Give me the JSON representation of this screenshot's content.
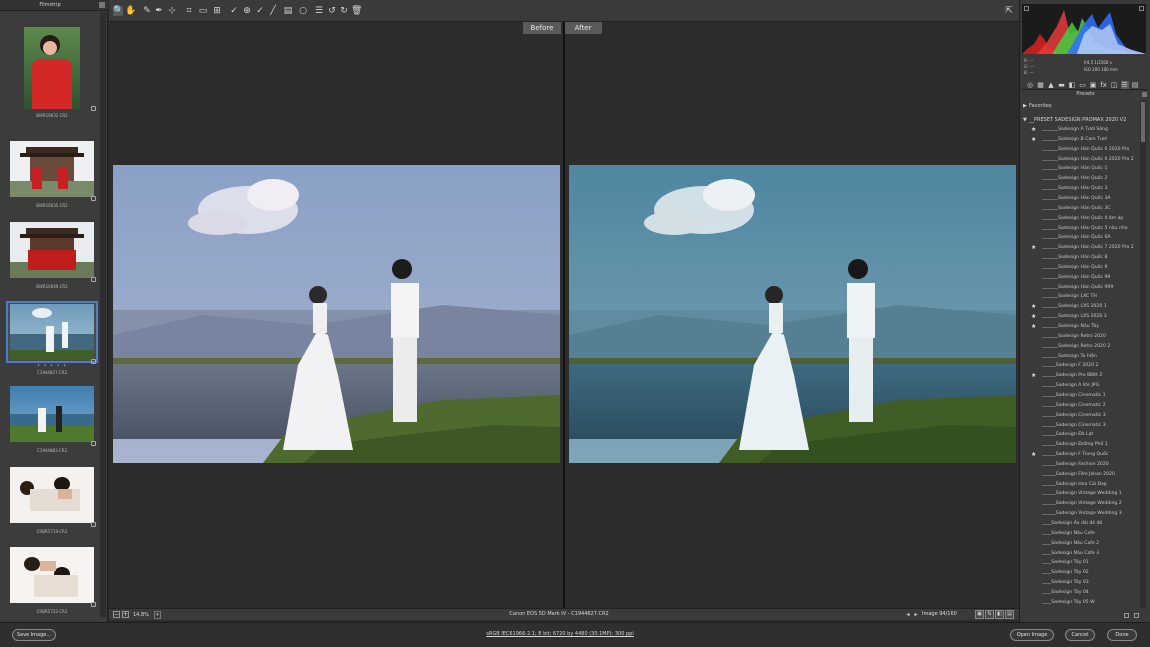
{
  "filmstrip": {
    "title": "Filmstrip",
    "items": [
      {
        "caption": "BWR10632.CR2",
        "thumb": "portrait-red-dress",
        "stars": ""
      },
      {
        "caption": "BWR10635.CR2",
        "thumb": "temple-couple",
        "stars": ""
      },
      {
        "caption": "BWR10649.CR2",
        "thumb": "temple-group",
        "stars": ""
      },
      {
        "caption": "C1944827.CR2",
        "thumb": "lake-couple",
        "stars": "• • • • •",
        "selected": true
      },
      {
        "caption": "C1944883.CR2",
        "thumb": "lake-couple-2",
        "stars": ""
      },
      {
        "caption": "C9DR5719.CR2",
        "thumb": "bed-couple",
        "stars": ""
      },
      {
        "caption": "C9DR5722.CR2",
        "thumb": "bed-couple-2",
        "stars": ""
      }
    ]
  },
  "toolbar": {
    "tools": [
      {
        "name": "zoom-tool",
        "glyph": "🔍"
      },
      {
        "name": "hand-tool",
        "glyph": "✋"
      },
      {
        "name": "white-balance-tool",
        "glyph": "✎"
      },
      {
        "name": "color-sampler-tool",
        "glyph": "✒"
      },
      {
        "name": "targeted-adjustment-tool",
        "glyph": "⊹"
      },
      {
        "name": "crop-tool",
        "glyph": "⌗"
      },
      {
        "name": "straighten-tool",
        "glyph": "▭"
      },
      {
        "name": "transform-tool",
        "glyph": "⊞"
      },
      {
        "name": "spot-removal-tool",
        "glyph": "✓"
      },
      {
        "name": "red-eye-tool",
        "glyph": "⊕"
      },
      {
        "name": "adjustment-brush-tool",
        "glyph": "✓"
      },
      {
        "name": "graduated-filter-tool",
        "glyph": "╱"
      },
      {
        "name": "radial-filter-tool",
        "glyph": "▤"
      },
      {
        "name": "preferences-tool",
        "glyph": "○"
      },
      {
        "name": "list-tool",
        "glyph": "☰"
      },
      {
        "name": "rotate-left-tool",
        "glyph": "↺"
      },
      {
        "name": "rotate-right-tool",
        "glyph": "↻"
      },
      {
        "name": "trash-tool",
        "glyph": "🗑"
      }
    ],
    "fullscreen_glyph": "⇱"
  },
  "preview": {
    "before_label": "Before",
    "after_label": "After"
  },
  "status": {
    "zoom": "14.8%",
    "camera": "Canon EOS 5D Mark IV  -  C1944827.CR2",
    "image_count": "Image 94/160"
  },
  "histogram": {
    "r_label": "R:",
    "g_label": "G:",
    "b_label": "B:",
    "r_value": "---",
    "g_value": "---",
    "b_value": "---",
    "exposure_line1": "f/4.5     1/2500 s",
    "exposure_line2": "ISO 200    100 mm"
  },
  "panel_tabs": [
    "◎",
    "▦",
    "▲",
    "▬",
    "◧",
    "▭",
    "▣",
    "fx",
    "◫",
    "☰",
    "▤"
  ],
  "presets": {
    "title": "Presets",
    "favorites_label": "Favorites",
    "group_label": "__PRESET SADESIGN PROMAX 2020 V2",
    "items": [
      {
        "name": "_______Sadesign A Tươi Sáng",
        "star": true
      },
      {
        "name": "_______Sadesign B  Cam Tươi",
        "star": true
      },
      {
        "name": "_______Sadesign Hàn Quốc 0 2020 Pro",
        "star": false
      },
      {
        "name": "_______Sadesign Hàn Quốc 0 2020 Pro 2",
        "star": false
      },
      {
        "name": "_______Sadesign Hàn Quốc 1",
        "star": false
      },
      {
        "name": "_______Sadesign Hàn Quốc 2",
        "star": false
      },
      {
        "name": "_______Sadesign Hàn Quốc 3",
        "star": false
      },
      {
        "name": "_______Sadesign Hàn Quốc 3A",
        "star": false
      },
      {
        "name": "_______Sadesign Hàn Quốc 3C",
        "star": false
      },
      {
        "name": "_______Sadesign Hàn Quốc 4 âm áp",
        "star": false
      },
      {
        "name": "_______Sadesign Hàn Quốc 5 nâu nhẹ",
        "star": false
      },
      {
        "name": "_______Sadesign Hàn Quốc 6A",
        "star": false
      },
      {
        "name": "_______Sadesign Hàn Quốc 7 2020 Pro 2",
        "star": true
      },
      {
        "name": "_______Sadesign Hàn Quốc 8",
        "star": false
      },
      {
        "name": "_______Sadesign Hàn Quốc 9",
        "star": false
      },
      {
        "name": "_______Sadesign Hàn Quốc 99",
        "star": false
      },
      {
        "name": "_______Sadesign Hàn Quốc 999",
        "star": false
      },
      {
        "name": "_______Sadesign LXC  TH",
        "star": false
      },
      {
        "name": "_______Sadesign LXS 2020 1",
        "star": true
      },
      {
        "name": "_______Sadesign LXS 2020 3",
        "star": true
      },
      {
        "name": "_______Sadesign Nâu Tây",
        "star": true
      },
      {
        "name": "_______Sadesign Retro 2020",
        "star": false
      },
      {
        "name": "_______Sadesign Retro 2020 2",
        "star": false
      },
      {
        "name": "_______Sadesign Ta hiện",
        "star": false
      },
      {
        "name": "______Sadesign  F 2020 2",
        "star": false
      },
      {
        "name": "______Sadesign  Pro 8Bitt 2",
        "star": true
      },
      {
        "name": "______Sadesign A lite JPG",
        "star": false
      },
      {
        "name": "______Sadesign Cinematic 1",
        "star": false
      },
      {
        "name": "______Sadesign Cinematic 2",
        "star": false
      },
      {
        "name": "______Sadesign Cinematic 3",
        "star": false
      },
      {
        "name": "______Sadesign Cinematic 3",
        "star": false
      },
      {
        "name": "______Sadesign Đà Lạt",
        "star": false
      },
      {
        "name": "______Sadesign Đường Phố 1",
        "star": false
      },
      {
        "name": "______Sadesign F Trung Quốc",
        "star": true
      },
      {
        "name": "______Sadesign Fashion 2020",
        "star": false
      },
      {
        "name": "______Sadesign Film Jahan 2020",
        "star": false
      },
      {
        "name": "______Sadesign Hoa Cái Đẹp",
        "star": false
      },
      {
        "name": "______Sadesign Vintage Wedding 1",
        "star": false
      },
      {
        "name": "______Sadesign Vintage Wedding 2",
        "star": false
      },
      {
        "name": "______Sadesign Vintage Wedding 3",
        "star": false
      },
      {
        "name": "____Sadesign Áo dài đỏ đỏ",
        "star": false
      },
      {
        "name": "____Sadesign Nâu Cafe",
        "star": false
      },
      {
        "name": "____Sadesign Nâu Cafe 2",
        "star": false
      },
      {
        "name": "____Sadesign Nâu Cafe 3",
        "star": false
      },
      {
        "name": "____Sadesign Tây 01",
        "star": false
      },
      {
        "name": "____Sadesign Tây 02",
        "star": false
      },
      {
        "name": "____Sadesign Tây 03",
        "star": false
      },
      {
        "name": "____Sadesign Tây 04",
        "star": false
      },
      {
        "name": "____Sadesign Tây 05 W",
        "star": false
      }
    ]
  },
  "bottom": {
    "save_label": "Save Image...",
    "workflow": "sRGB IEC61966-2.1; 8 bit; 6720 by 4480 (30.1MP); 300 ppi",
    "open_label": "Open Image",
    "cancel_label": "Cancel",
    "done_label": "Done"
  }
}
